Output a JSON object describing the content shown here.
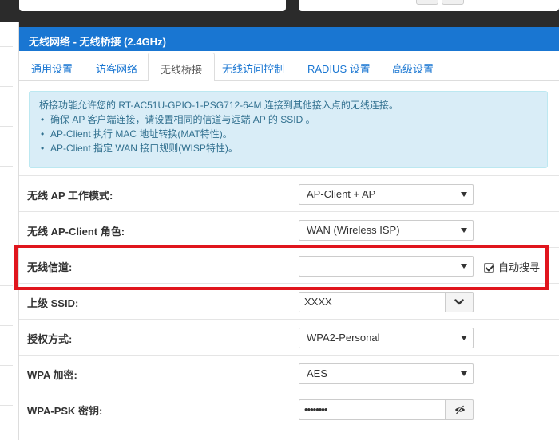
{
  "panel": {
    "title": "无线网络 - 无线桥接 (2.4GHz)"
  },
  "tabs": [
    {
      "label": "通用设置"
    },
    {
      "label": "访客网络"
    },
    {
      "label": "无线桥接"
    },
    {
      "label": "无线访问控制"
    },
    {
      "label": "RADIUS 设置"
    },
    {
      "label": "高级设置"
    }
  ],
  "info": {
    "intro": "桥接功能允许您的 RT-AC51U-GPIO-1-PSG712-64M 连接到其他接入点的无线连接。",
    "bullets": [
      "确保 AP 客户端连接，请设置相同的信道与远端 AP 的 SSID 。",
      "AP-Client 执行 MAC 地址转换(MAT特性)。",
      "AP-Client 指定 WAN 接口规则(WISP特性)。"
    ]
  },
  "form": {
    "ap_mode": {
      "label": "无线 AP 工作模式:",
      "value": "AP-Client + AP"
    },
    "ap_client_role": {
      "label": "无线 AP-Client 角色:",
      "value": "WAN (Wireless ISP)"
    },
    "channel": {
      "label": "无线信道:",
      "value": "",
      "auto_label": "自动搜寻",
      "auto_checked": true
    },
    "ssid": {
      "label": "上级 SSID:",
      "value": "XXXX"
    },
    "auth": {
      "label": "授权方式:",
      "value": "WPA2-Personal"
    },
    "encryption": {
      "label": "WPA 加密:",
      "value": "AES"
    },
    "psk": {
      "label": "WPA-PSK 密钥:",
      "value": "••••••••"
    }
  },
  "colors": {
    "header": "#1976d2",
    "highlight": "#e0151d",
    "info_bg": "#d9edf7"
  }
}
